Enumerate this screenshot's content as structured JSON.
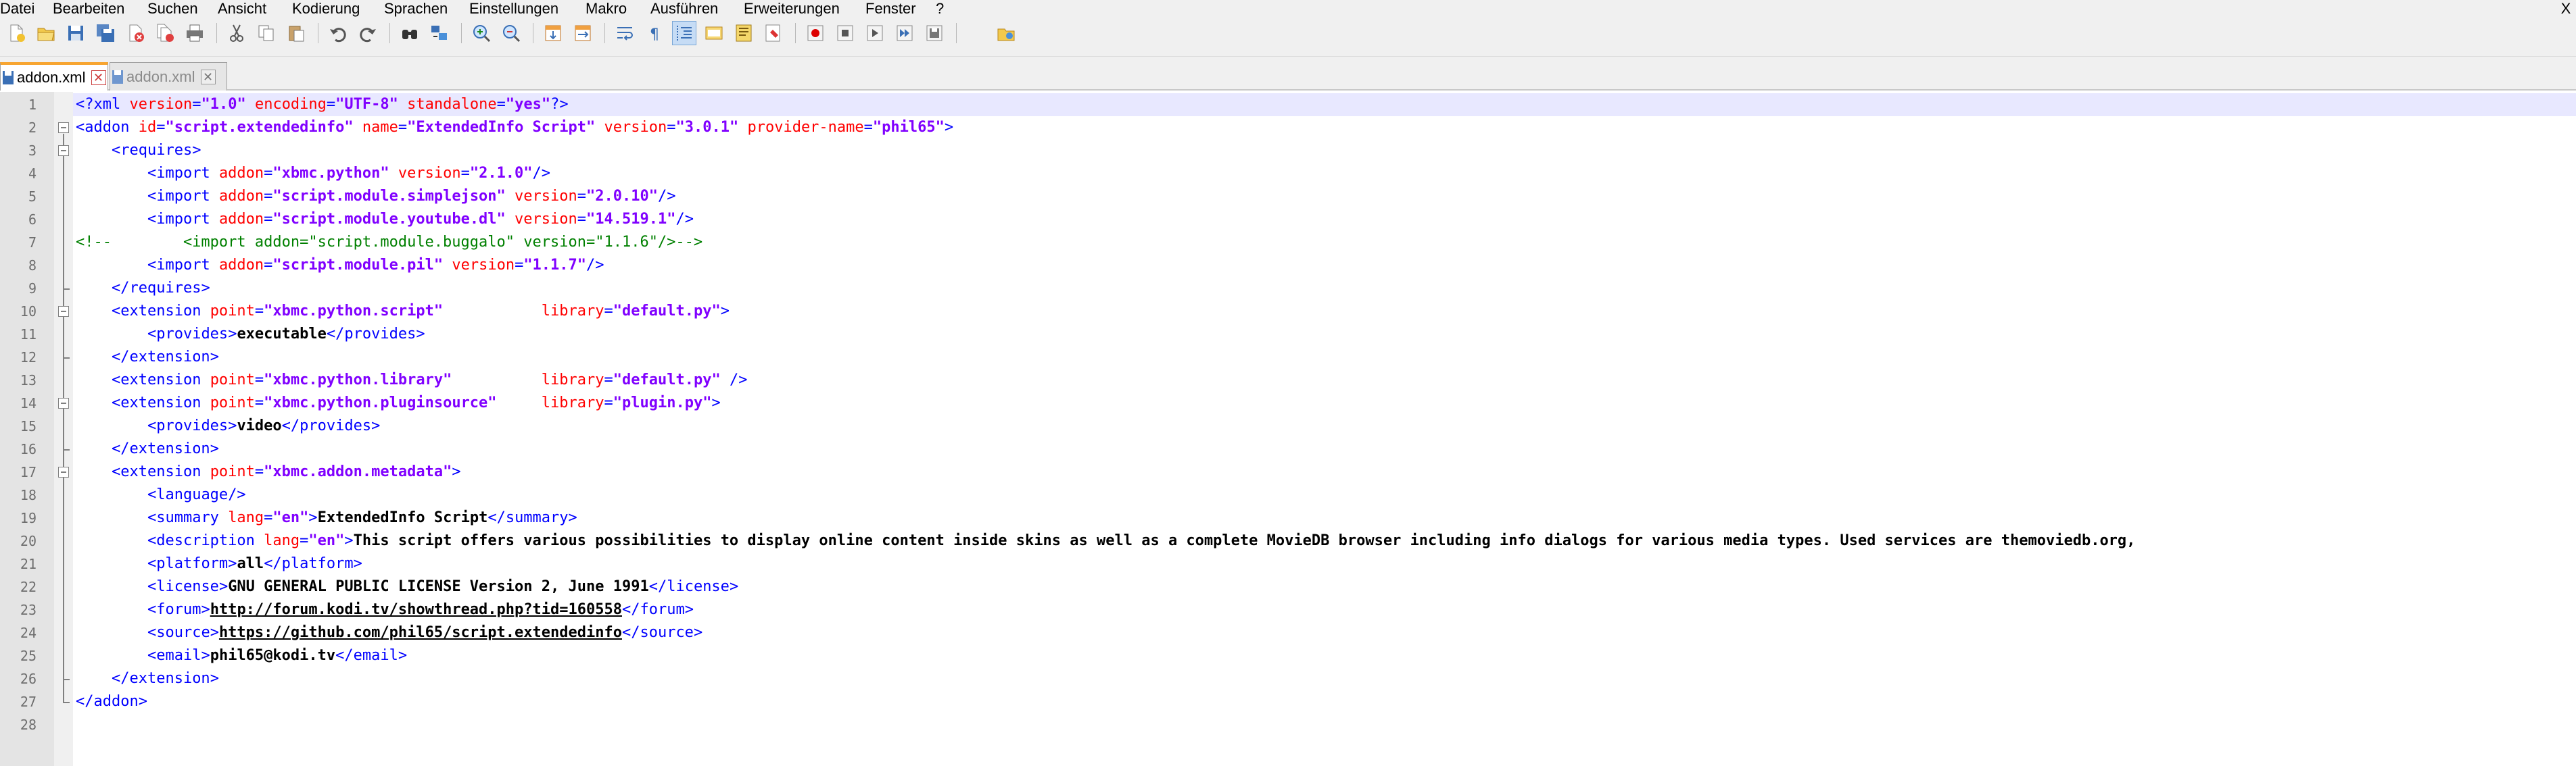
{
  "menu": {
    "items": [
      "Datei",
      "Bearbeiten",
      "Suchen",
      "Ansicht",
      "Kodierung",
      "Sprachen",
      "Einstellungen",
      "Makro",
      "Ausführen",
      "Erweiterungen",
      "Fenster",
      "?"
    ],
    "close_glyph": "X"
  },
  "toolbar": {
    "icons": [
      "new-file-icon",
      "open-file-icon",
      "save-icon",
      "save-all-icon",
      "close-icon",
      "close-all-icon",
      "print-icon",
      "cut-icon",
      "copy-icon",
      "paste-icon",
      "undo-icon",
      "redo-icon",
      "find-icon",
      "replace-icon",
      "zoom-in-icon",
      "zoom-out-icon",
      "sync-vertical-icon",
      "sync-horizontal-icon",
      "word-wrap-icon",
      "show-all-chars-icon",
      "indent-guide-icon",
      "function-list-icon",
      "document-map-icon",
      "doc-switcher-icon",
      "record-macro-icon",
      "stop-macro-icon",
      "play-macro-icon",
      "run-macro-multiple-icon",
      "save-macro-icon",
      "launch-browser-icon"
    ],
    "active_icon": "indent-guide-icon"
  },
  "tabs": [
    {
      "label": "addon.xml",
      "active": true
    },
    {
      "label": "addon.xml",
      "active": false
    }
  ],
  "editor": {
    "current_line": 1,
    "lines": [
      "<?xml version=\"1.0\" encoding=\"UTF-8\" standalone=\"yes\"?>",
      "<addon id=\"script.extendedinfo\" name=\"ExtendedInfo Script\" version=\"3.0.1\" provider-name=\"phil65\">",
      "    <requires>",
      "        <import addon=\"xbmc.python\" version=\"2.1.0\"/>",
      "        <import addon=\"script.module.simplejson\" version=\"2.0.10\"/>",
      "        <import addon=\"script.module.youtube.dl\" version=\"14.519.1\"/>",
      "<!--        <import addon=\"script.module.buggalo\" version=\"1.1.6\"/>-->",
      "        <import addon=\"script.module.pil\" version=\"1.1.7\"/>",
      "    </requires>",
      "    <extension point=\"xbmc.python.script\"           library=\"default.py\">",
      "        <provides>executable</provides>",
      "    </extension>",
      "    <extension point=\"xbmc.python.library\"          library=\"default.py\" />",
      "    <extension point=\"xbmc.python.pluginsource\"     library=\"plugin.py\">",
      "        <provides>video</provides>",
      "    </extension>",
      "    <extension point=\"xbmc.addon.metadata\">",
      "        <language/>",
      "        <summary lang=\"en\">ExtendedInfo Script</summary>",
      "        <description lang=\"en\">This script offers various possibilities to display online content inside skins as well as a complete MovieDB browser including info dialogs for various media types. Used services are themoviedb.org,",
      "        <platform>all</platform>",
      "        <license>GNU GENERAL PUBLIC LICENSE Version 2, June 1991</license>",
      "        <forum>http://forum.kodi.tv/showthread.php?tid=160558</forum>",
      "        <source>https://github.com/phil65/script.extendedinfo</source>",
      "        <email>phil65@kodi.tv</email>",
      "    </extension>",
      "</addon>",
      ""
    ]
  },
  "colors": {
    "tag": "#0000ff",
    "attribute": "#ff0000",
    "attribute_value": "#8000ff",
    "comment": "#008000",
    "current_line_bg": "#e8e8ff",
    "active_tab_accent": "#f7a531"
  }
}
